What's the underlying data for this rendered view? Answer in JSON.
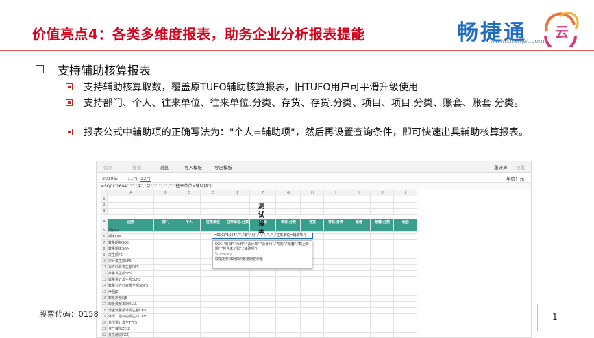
{
  "slide": {
    "title": "价值亮点4：各类多维度报表，助务企业分析报表提能",
    "logo_text": "畅捷通",
    "logo_url": "www.chanjet.com",
    "heading": "支持辅助核算报表",
    "bullets": [
      "支持辅助核算取数，覆盖原TUFO辅助核算报表，旧TUFO用户可平滑升级使用",
      "支持部门、个人、往来单位、往来单位.分类、存货、存货.分类、项目、项目.分类、账套、账套.分类。",
      "报表公式中辅助项的正确写法为：\"个人=辅助项\"，然后再设置查询条件，即可快速出具辅助核算报表。"
    ],
    "footer_code": "股票代码：0158",
    "page_number": "1"
  },
  "screenshot": {
    "toolbar": [
      "保存",
      "撤销",
      "浏览",
      "导入模板",
      "导出模板",
      "重计算",
      "设置"
    ],
    "tabs": [
      "2019年",
      "11月",
      "12月"
    ],
    "unit_label": "单位：元",
    "formula": "=SQC(\"1604\",\"\",\"年\",\"月\",\"\",\"\",\"\",\"\",\"往来单位=辅助项\")",
    "report_title": "测试报表",
    "col_letters": [
      "A",
      "B",
      "C",
      "D",
      "E",
      "F",
      "G",
      "H",
      "I",
      "J",
      "K",
      "L"
    ],
    "header_cells": [
      "函数",
      "部门",
      "个人",
      "往来单位",
      "往来单位.分类",
      "项目",
      "项目.分类",
      "存货",
      "存货.分类",
      "账套",
      "账套.分类",
      "组合"
    ],
    "row_numbers": [
      "1",
      "2",
      "3",
      "4",
      "5",
      "6",
      "7",
      "8",
      "9",
      "10",
      "11",
      "12",
      "13",
      "14",
      "15",
      "16",
      "17",
      "18",
      "19",
      "20",
      "21",
      "22",
      "23"
    ],
    "row_labels": [
      "期初QC",
      "期末QM",
      "数量期初SQC",
      "数量期末SQM",
      "发生额FS",
      "累计发生额LFS",
      "对方科目发生额DFS",
      "数量发生额SFS",
      "数量累计发生额SLFS",
      "数量对方科目发生额SDFS",
      "净额JE",
      "数量净额SJE",
      "现金流量本期XLLL",
      "现金流量累计发生额LXLL",
      "外币、指标的发生ZJTXFS",
      "外币累计发生TYFS",
      "资产减值ZCJZ",
      "负债增减FZZJ",
      "现金的期初XQC"
    ],
    "active_cell": "=SQC(\"1604\",\"\",\"年\",\"月\",\"\",\"\",\"\",\"\",\"往来单位=辅助项\")",
    "popup_signature": "SQC(\"科目\",\"币种\",\"会计年\",\"会计月\",\"方向\",\"账套\",\"截止日期\",\"包含未记账\",\"辅助项\")",
    "popup_summary_label": "Summary",
    "popup_summary": "取指定科目期初的数量期初余额"
  }
}
